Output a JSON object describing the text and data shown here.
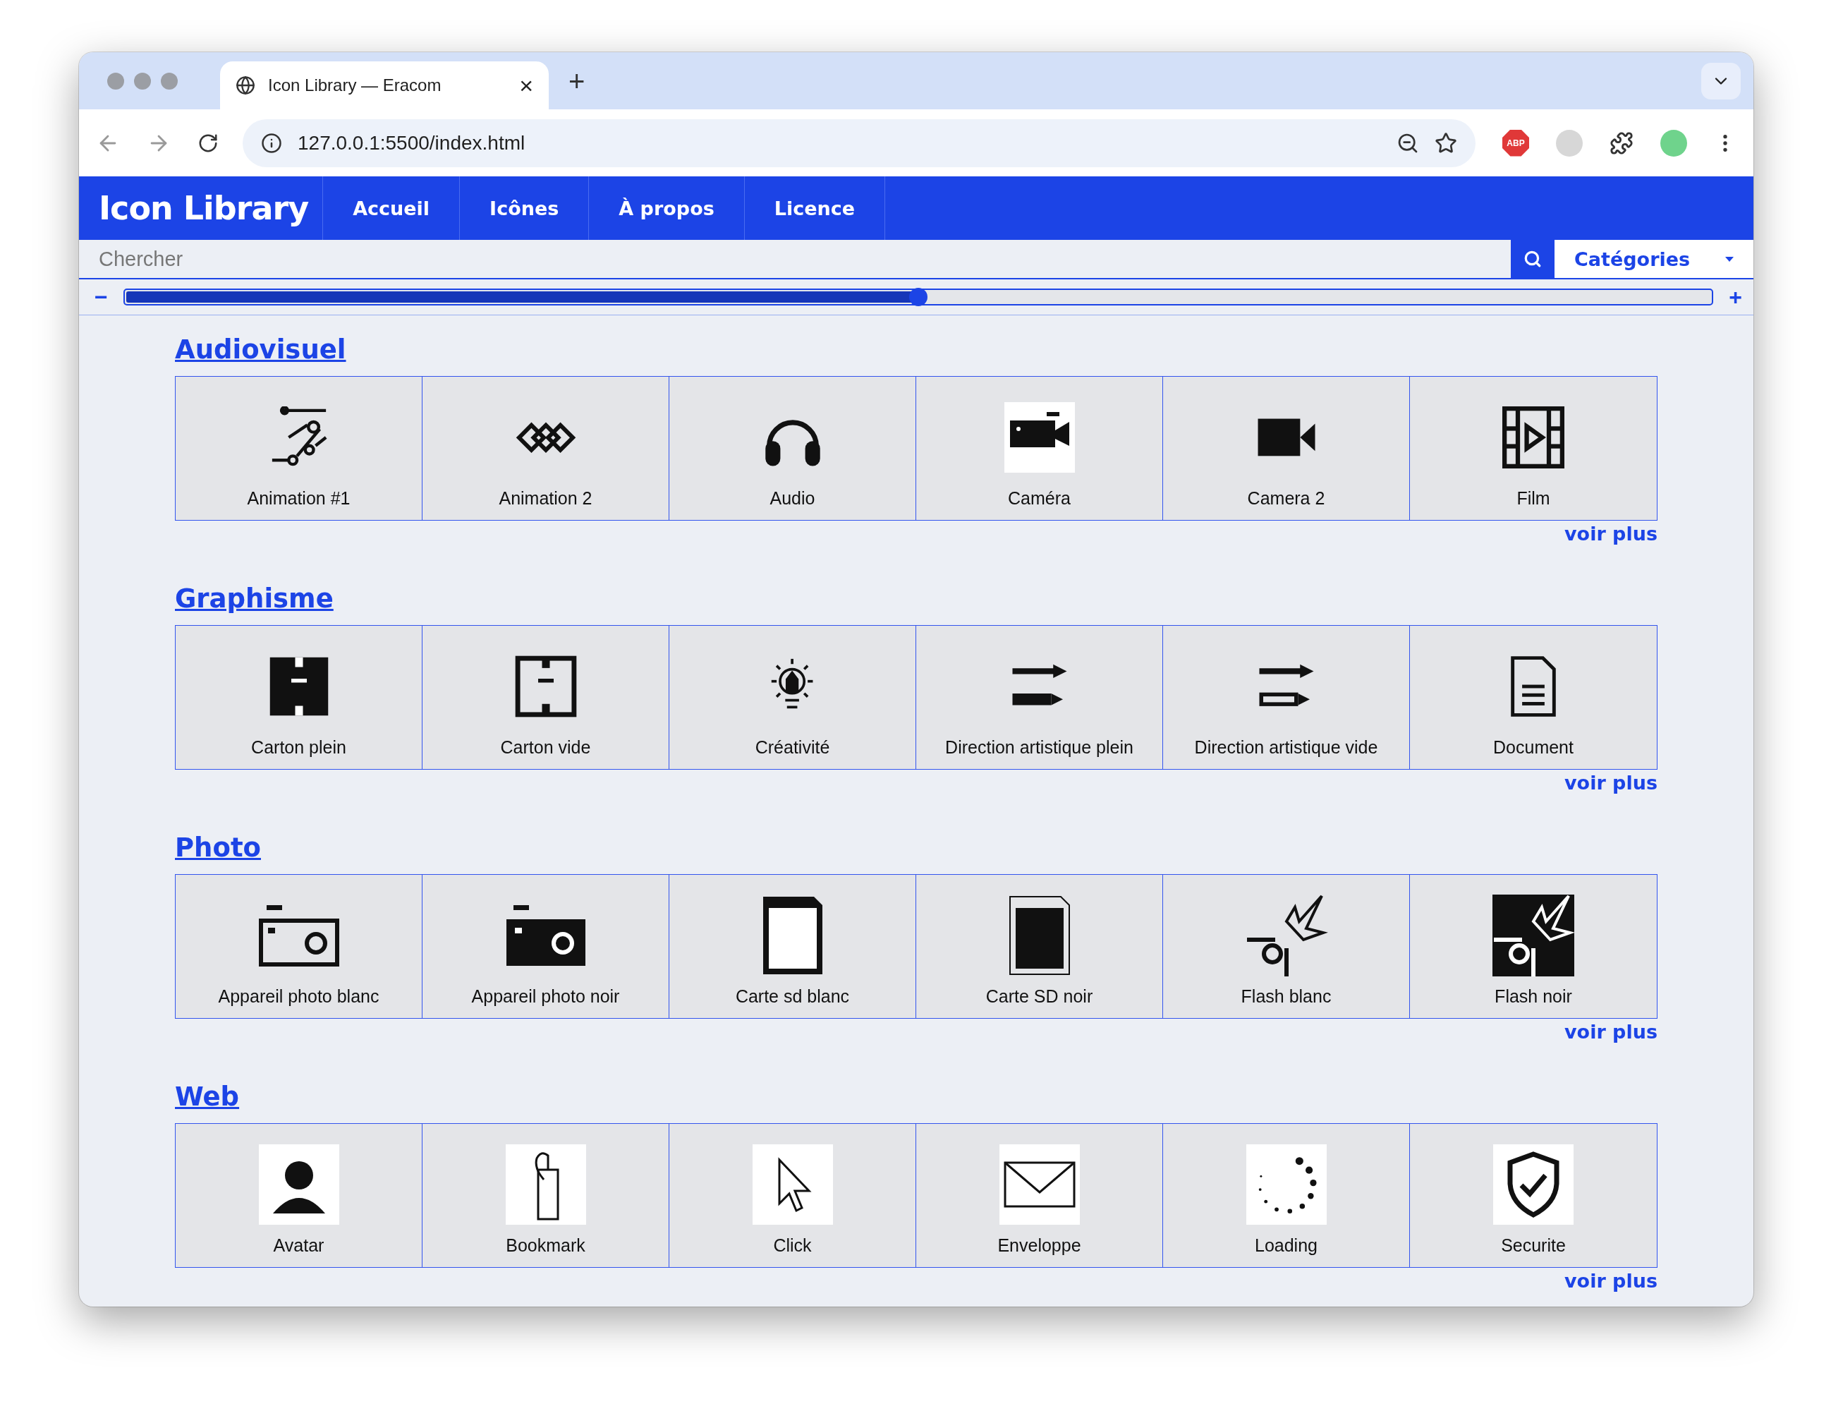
{
  "browser": {
    "tab_title": "Icon Library — Eracom",
    "tab_close": "×",
    "new_tab": "+",
    "url": "127.0.0.1:5500/index.html",
    "extension_badge": "ABP"
  },
  "nav": {
    "logo": "Icon Library",
    "items": [
      {
        "label": "Accueil"
      },
      {
        "label": "Icônes"
      },
      {
        "label": "À propos"
      },
      {
        "label": "Licence"
      }
    ]
  },
  "search": {
    "placeholder": "Chercher",
    "categories": "Catégories"
  },
  "zoom_slider": {
    "minus": "−",
    "plus": "+",
    "level": 0.5
  },
  "sections": [
    {
      "title": "Audiovisuel",
      "more": "voir plus",
      "items": [
        {
          "label": "Animation #1"
        },
        {
          "label": "Animation 2"
        },
        {
          "label": "Audio"
        },
        {
          "label": "Caméra"
        },
        {
          "label": "Camera 2"
        },
        {
          "label": "Film"
        }
      ]
    },
    {
      "title": "Graphisme",
      "more": "voir plus",
      "items": [
        {
          "label": "Carton plein"
        },
        {
          "label": "Carton vide"
        },
        {
          "label": "Créativité"
        },
        {
          "label": "Direction artistique plein"
        },
        {
          "label": "Direction artistique vide"
        },
        {
          "label": "Document"
        }
      ]
    },
    {
      "title": "Photo",
      "more": "voir plus",
      "items": [
        {
          "label": "Appareil photo blanc"
        },
        {
          "label": "Appareil photo noir"
        },
        {
          "label": "Carte sd blanc"
        },
        {
          "label": "Carte SD noir"
        },
        {
          "label": "Flash blanc"
        },
        {
          "label": "Flash noir"
        }
      ]
    },
    {
      "title": "Web",
      "more": "voir plus",
      "items": [
        {
          "label": "Avatar"
        },
        {
          "label": "Bookmark"
        },
        {
          "label": "Click"
        },
        {
          "label": "Enveloppe"
        },
        {
          "label": "Loading"
        },
        {
          "label": "Securite"
        }
      ]
    }
  ]
}
